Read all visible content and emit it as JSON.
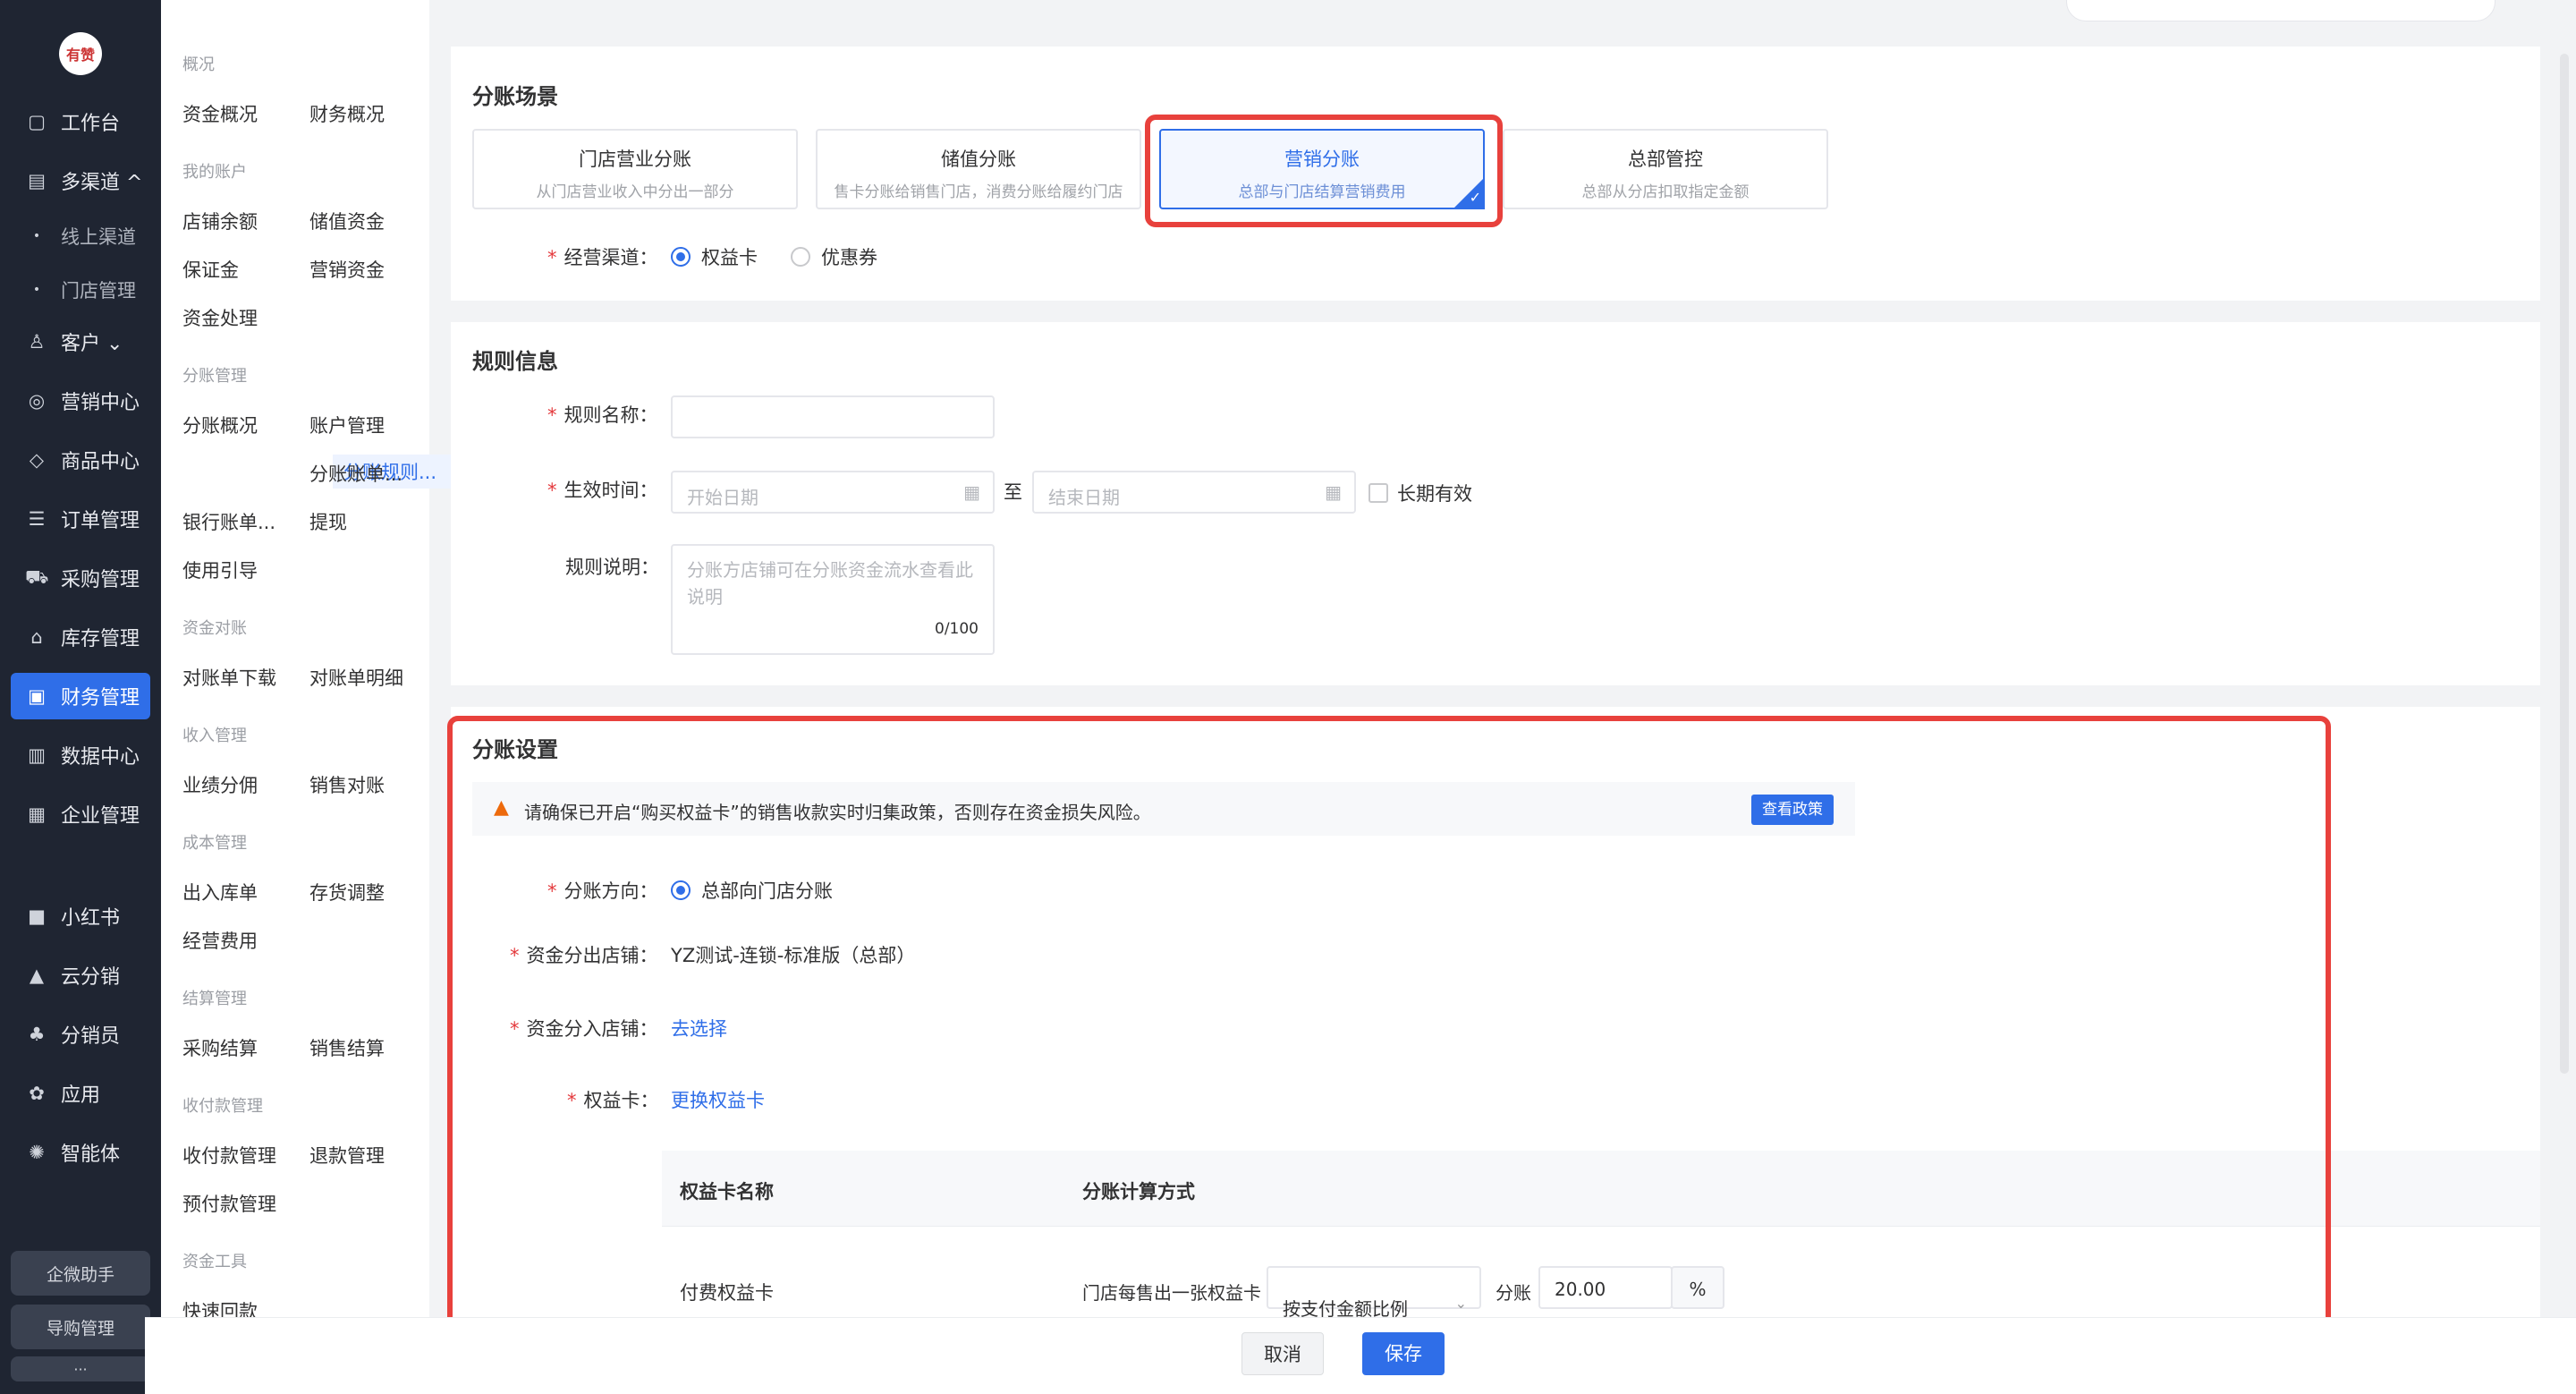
{
  "rail": {
    "logo_text": "有赞",
    "items": [
      {
        "label": "工作台",
        "icon": "workbench-icon",
        "glyph": "▢"
      },
      {
        "label": "多渠道 ^",
        "icon": "channel-icon",
        "glyph": "▤"
      },
      {
        "label": "线上渠道",
        "icon": "dot-icon",
        "glyph": "•"
      },
      {
        "label": "门店管理",
        "icon": "dot-icon",
        "glyph": "•"
      },
      {
        "label": "客户 ⌄",
        "icon": "customer-icon",
        "glyph": "♙"
      },
      {
        "label": "营销中心",
        "icon": "marketing-icon",
        "glyph": "◎"
      },
      {
        "label": "商品中心",
        "icon": "goods-icon",
        "glyph": "◇"
      },
      {
        "label": "订单管理",
        "icon": "order-icon",
        "glyph": "☰"
      },
      {
        "label": "采购管理",
        "icon": "cart-icon",
        "glyph": "⛟"
      },
      {
        "label": "库存管理",
        "icon": "warehouse-icon",
        "glyph": "⌂"
      },
      {
        "label": "财务管理",
        "icon": "finance-icon",
        "glyph": "▣"
      },
      {
        "label": "数据中心",
        "icon": "data-icon",
        "glyph": "▥"
      },
      {
        "label": "企业管理",
        "icon": "enterprise-icon",
        "glyph": "▦"
      },
      {
        "label": "小红书",
        "icon": "xiaohongshu-icon",
        "glyph": "■"
      },
      {
        "label": "云分销",
        "icon": "cloud-distribution-icon",
        "glyph": "▲"
      },
      {
        "label": "分销员",
        "icon": "distributor-icon",
        "glyph": "♣"
      },
      {
        "label": "应用",
        "icon": "apps-icon",
        "glyph": "✿"
      },
      {
        "label": "智能体",
        "icon": "agent-icon",
        "glyph": "✺"
      }
    ],
    "bottom_buttons": [
      "企微助手",
      "导购管理",
      "···"
    ]
  },
  "subnav": {
    "groups": [
      "概况",
      "我的账户",
      "分账管理",
      "资金对账",
      "收入管理",
      "成本管理",
      "结算管理",
      "收付款管理",
      "资金工具"
    ],
    "links": [
      "资金概况",
      "财务概况",
      "店铺余额",
      "储值资金",
      "保证金",
      "营销资金",
      "资金处理",
      "分账概况",
      "账户管理",
      "分账规则...",
      "分账账单...",
      "银行账单...",
      "提现",
      "使用引导",
      "对账单下载",
      "对账单明细",
      "业绩分佣",
      "销售对账",
      "出入库单",
      "存货调整",
      "经营费用",
      "采购结算",
      "销售结算",
      "收付款管理",
      "退款管理",
      "预付款管理",
      "快速回款"
    ]
  },
  "scene_section": {
    "title": "分账场景",
    "scenes": [
      {
        "title": "门店营业分账",
        "desc": "从门店营业收入中分出一部分"
      },
      {
        "title": "储值分账",
        "desc": "售卡分账给销售门店，消费分账给履约门店"
      },
      {
        "title": "营销分账",
        "desc": "总部与门店结算营销费用"
      },
      {
        "title": "总部管控",
        "desc": "总部从分店扣取指定金额"
      }
    ],
    "channel_label": "经营渠道：",
    "channel_options": [
      "权益卡",
      "优惠券"
    ]
  },
  "rule_section": {
    "title": "规则信息",
    "name_label": "规则名称：",
    "time_label": "生效时间：",
    "start_placeholder": "开始日期",
    "to_text": "至",
    "end_placeholder": "结束日期",
    "long_term": "长期有效",
    "desc_label": "规则说明：",
    "desc_placeholder": "分账方店铺可在分账资金流水查看此说明",
    "desc_count": "0/100"
  },
  "split_section": {
    "title": "分账设置",
    "notice": "请确保已开启“购买权益卡”的销售收款实时归集政策，否则存在资金损失风险。",
    "notice_button": "查看政策",
    "direction_label": "分账方向：",
    "direction_value": "总部向门店分账",
    "out_label": "资金分出店铺：",
    "out_value": "YZ测试-连锁-标准版（总部）",
    "in_label": "资金分入店铺：",
    "in_link": "去选择",
    "card_label": "权益卡：",
    "card_link": "更换权益卡",
    "table": {
      "headers": [
        "权益卡名称",
        "分账计算方式"
      ],
      "rows": [
        {
          "name": "付费权益卡",
          "prefix": "门店每售出一张权益卡",
          "method": "按支付金额比例",
          "split_word": "分账",
          "value": "20.00",
          "unit": "%"
        }
      ]
    }
  },
  "footer": {
    "cancel": "取消",
    "save": "保存"
  }
}
